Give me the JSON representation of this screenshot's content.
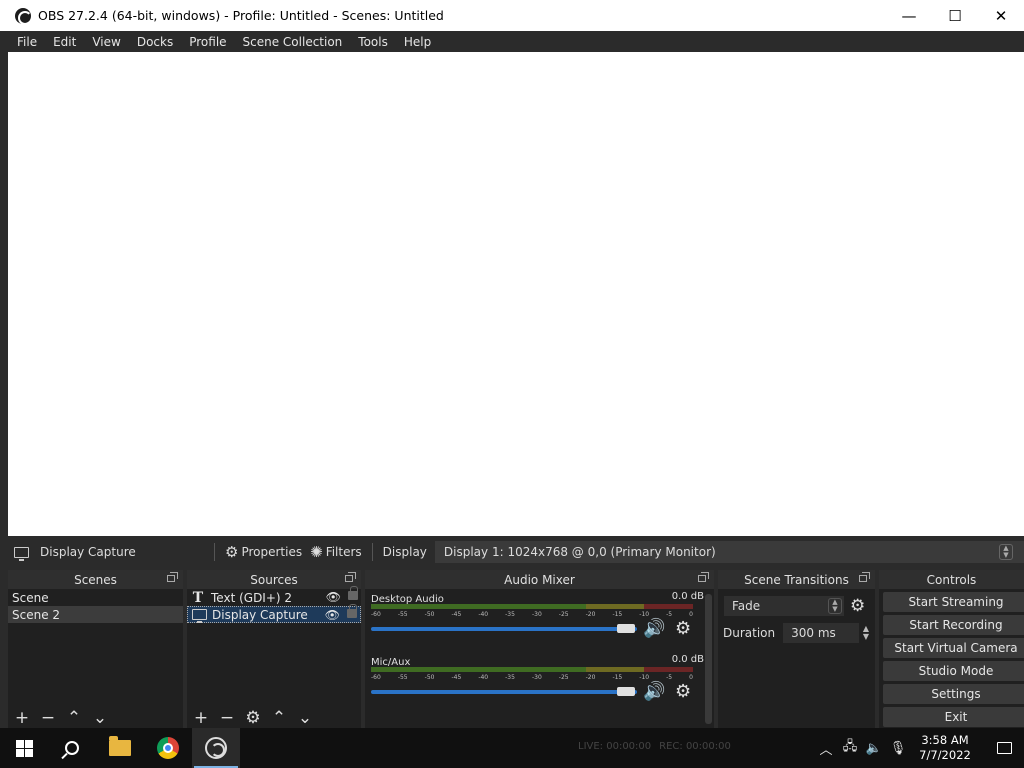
{
  "window": {
    "title": "OBS 27.2.4 (64-bit, windows) - Profile: Untitled - Scenes: Untitled",
    "minimize": "—",
    "maximize": "☐",
    "close": "✕"
  },
  "menu": [
    "File",
    "Edit",
    "View",
    "Docks",
    "Profile",
    "Scene Collection",
    "Tools",
    "Help"
  ],
  "context_bar": {
    "source_name": "Display Capture",
    "properties_label": "Properties",
    "filters_label": "Filters",
    "display_label": "Display",
    "display_value": "Display 1: 1024x768 @ 0,0 (Primary Monitor)"
  },
  "scenes": {
    "title": "Scenes",
    "items": [
      "Scene",
      "Scene 2"
    ],
    "selected": "Scene 2"
  },
  "sources": {
    "title": "Sources",
    "items": [
      {
        "name": "Text (GDI+) 2",
        "icon": "text-icon"
      },
      {
        "name": "Display Capture",
        "icon": "monitor-icon"
      }
    ]
  },
  "audio_mixer": {
    "title": "Audio Mixer",
    "ticks": [
      "-60",
      "-55",
      "-50",
      "-45",
      "-40",
      "-35",
      "-30",
      "-25",
      "-20",
      "-15",
      "-10",
      "-5",
      "0"
    ],
    "channels": [
      {
        "name": "Desktop Audio",
        "db": "0.0 dB"
      },
      {
        "name": "Mic/Aux",
        "db": "0.0 dB"
      }
    ]
  },
  "transitions": {
    "title": "Scene Transitions",
    "selected": "Fade",
    "duration_label": "Duration",
    "duration_value": "300 ms"
  },
  "controls": {
    "title": "Controls",
    "buttons": [
      "Start Streaming",
      "Start Recording",
      "Start Virtual Camera",
      "Studio Mode",
      "Settings",
      "Exit"
    ]
  },
  "status_bar": {
    "live": "LIVE: 00:00:00",
    "rec": "REC: 00:00:00"
  },
  "taskbar": {
    "time": "3:58 AM",
    "date": "7/7/2022"
  }
}
